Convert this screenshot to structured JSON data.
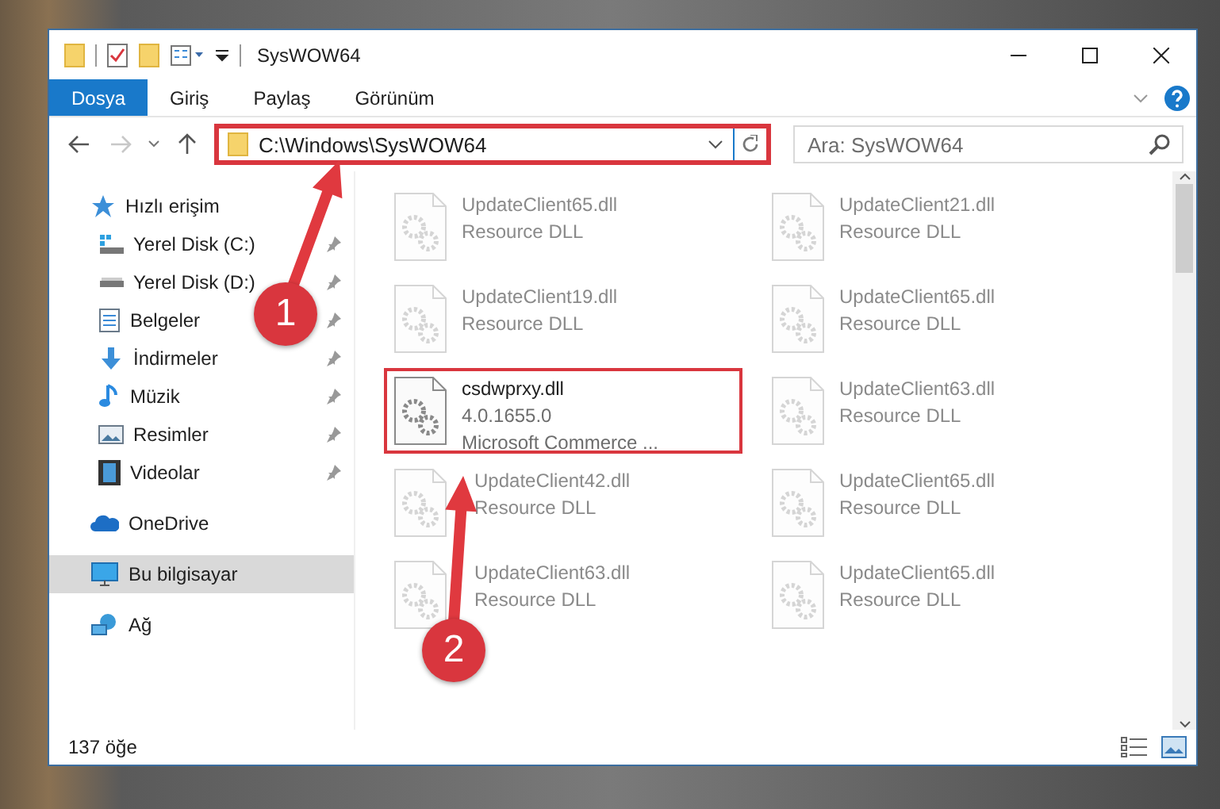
{
  "window": {
    "title": "SysWOW64"
  },
  "ribbon_tabs": [
    {
      "label": "Dosya",
      "selected": true
    },
    {
      "label": "Giriş",
      "selected": false
    },
    {
      "label": "Paylaş",
      "selected": false
    },
    {
      "label": "Görünüm",
      "selected": false
    }
  ],
  "address_bar": {
    "path": "C:\\Windows\\SysWOW64",
    "highlighted": true
  },
  "search": {
    "placeholder": "Ara: SysWOW64"
  },
  "sidebar": {
    "items": [
      {
        "label": "Hızlı erişim",
        "kind": "star",
        "selected": false,
        "children": [
          {
            "label": "Yerel Disk (C:)",
            "kind": "system-drive",
            "pinned": true,
            "selected": false
          },
          {
            "label": "Yerel Disk (D:)",
            "kind": "drive",
            "pinned": true,
            "selected": false
          },
          {
            "label": "Belgeler",
            "kind": "documents",
            "pinned": true,
            "selected": false
          },
          {
            "label": "İndirmeler",
            "kind": "downloads",
            "pinned": true,
            "selected": false
          },
          {
            "label": "Müzik",
            "kind": "music",
            "pinned": true,
            "selected": false
          },
          {
            "label": "Resimler",
            "kind": "pictures",
            "pinned": true,
            "selected": false
          },
          {
            "label": "Videolar",
            "kind": "videos",
            "pinned": true,
            "selected": false
          }
        ]
      },
      {
        "label": "OneDrive",
        "kind": "cloud",
        "selected": false
      },
      {
        "label": "Bu bilgisayar",
        "kind": "computer",
        "selected": true
      },
      {
        "label": "Ağ",
        "kind": "network",
        "selected": false
      }
    ]
  },
  "files": [
    {
      "name": "UpdateClient65.dll",
      "lines": [
        "Resource DLL"
      ],
      "faded": true,
      "highlighted": false
    },
    {
      "name": "UpdateClient21.dll",
      "lines": [
        "Resource DLL"
      ],
      "faded": true,
      "highlighted": false
    },
    {
      "name": "UpdateClient19.dll",
      "lines": [
        "Resource DLL"
      ],
      "faded": true,
      "highlighted": false
    },
    {
      "name": "UpdateClient65.dll",
      "lines": [
        "Resource DLL"
      ],
      "faded": true,
      "highlighted": false
    },
    {
      "name": "csdwprxy.dll",
      "lines": [
        "4.0.1655.0",
        "Microsoft Commerce ..."
      ],
      "faded": false,
      "highlighted": true
    },
    {
      "name": "UpdateClient63.dll",
      "lines": [
        "Resource DLL"
      ],
      "faded": true,
      "highlighted": false
    },
    {
      "name": "UpdateClient42.dll",
      "lines": [
        "Resource DLL"
      ],
      "faded": true,
      "highlighted": false
    },
    {
      "name": "UpdateClient65.dll",
      "lines": [
        "Resource DLL"
      ],
      "faded": true,
      "highlighted": false
    },
    {
      "name": "UpdateClient63.dll",
      "lines": [
        "Resource DLL"
      ],
      "faded": true,
      "highlighted": false
    },
    {
      "name": "UpdateClient65.dll",
      "lines": [
        "Resource DLL"
      ],
      "faded": true,
      "highlighted": false
    }
  ],
  "status_bar": {
    "item_count": "137 öğe"
  },
  "annotations": [
    {
      "label": "1"
    },
    {
      "label": "2"
    }
  ]
}
